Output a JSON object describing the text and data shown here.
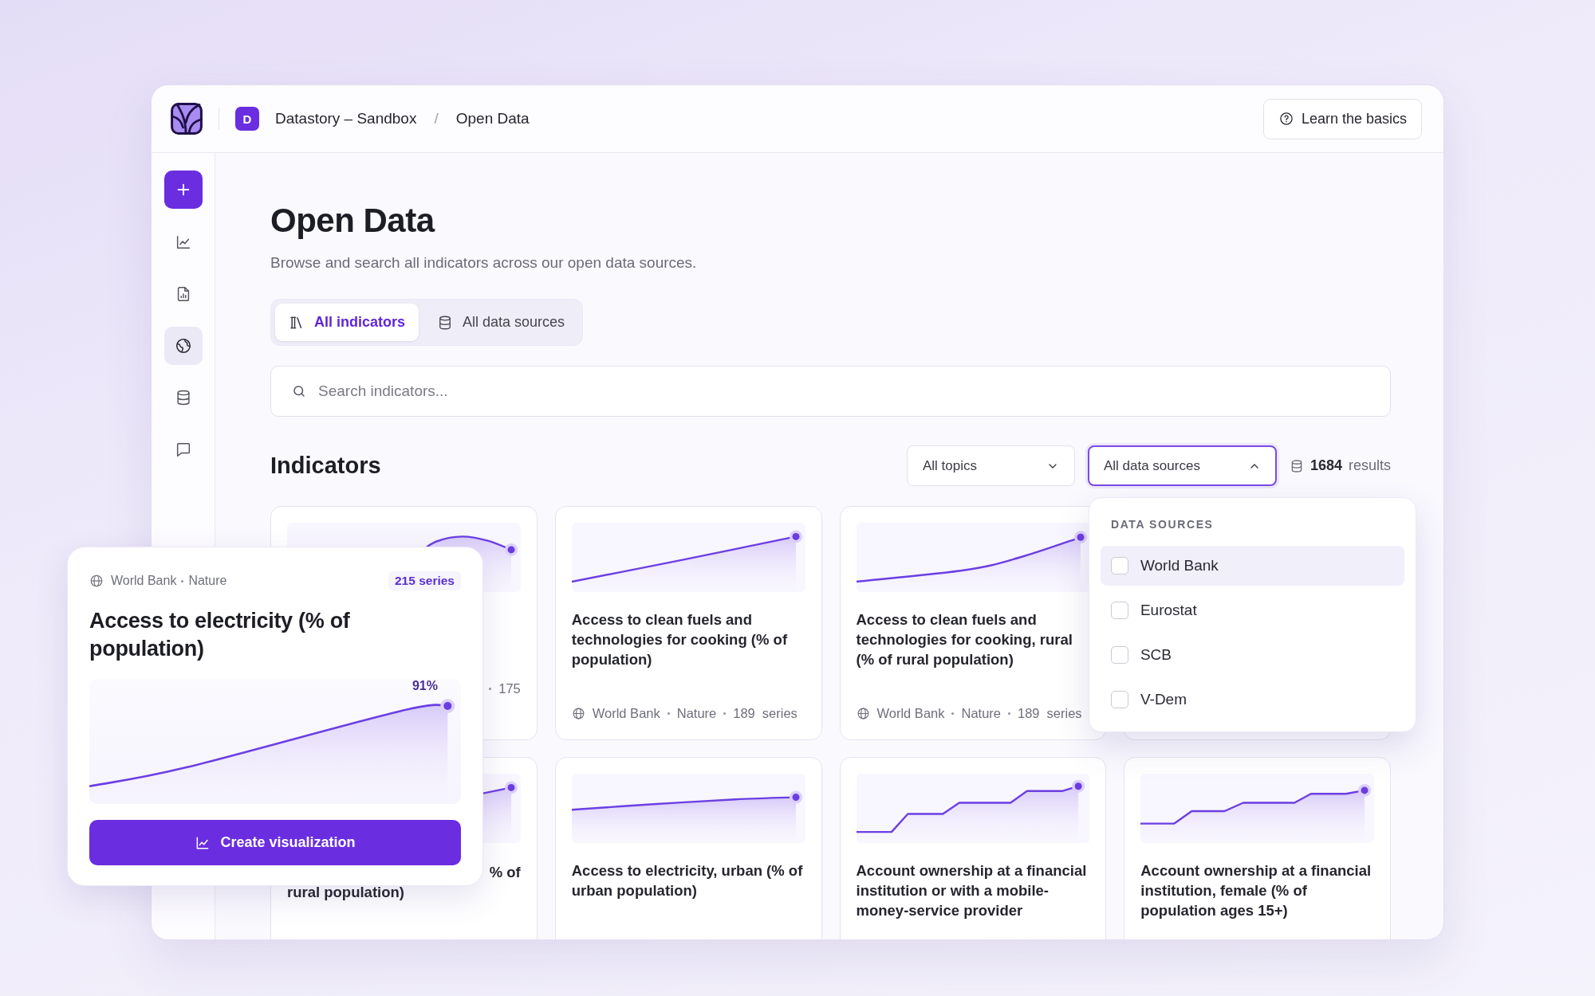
{
  "header": {
    "workspace_badge": "D",
    "workspace": "Datastory – Sandbox",
    "separator": "/",
    "page": "Open Data",
    "help_button": "Learn the basics"
  },
  "sidebar": {
    "items": [
      {
        "selected": false
      },
      {
        "selected": false
      },
      {
        "selected": true
      },
      {
        "selected": false
      },
      {
        "selected": false
      }
    ]
  },
  "page": {
    "title": "Open Data",
    "subtitle": "Browse and search all indicators across our open data sources."
  },
  "tabs": [
    {
      "label": "All indicators",
      "selected": true
    },
    {
      "label": "All data sources",
      "selected": false
    }
  ],
  "search": {
    "placeholder": "Search indicators..."
  },
  "indicators": {
    "heading": "Indicators",
    "filters": [
      {
        "label": "All topics",
        "expanded": false
      },
      {
        "label": "All data sources",
        "expanded": true,
        "menu": {
          "heading": "DATA SOURCES",
          "options": [
            {
              "label": "World Bank",
              "checked": false,
              "hovered": true
            },
            {
              "label": "Eurostat",
              "checked": false,
              "hovered": false
            },
            {
              "label": "SCB",
              "checked": false,
              "hovered": false
            },
            {
              "label": "V-Dem",
              "checked": false,
              "hovered": false
            }
          ]
        }
      }
    ],
    "result_count": "1684",
    "result_label": "results",
    "cards": [
      {
        "kind": "hump",
        "meta": {
          "count": "175"
        }
      },
      {
        "kind": "linear",
        "title": "Access to clean fuels and technologies for cooking (% of population)",
        "meta": {
          "source": "World Bank",
          "topic": "Nature",
          "count": "189",
          "unit": "series"
        }
      },
      {
        "kind": "curve",
        "title": "Access to clean fuels and technologies for cooking, rural (% of rural population)",
        "meta": {
          "source": "World Bank",
          "topic": "Nature",
          "count": "189",
          "unit": "series"
        }
      },
      {
        "kind": "covered"
      },
      {
        "kind": "linear",
        "title_lines": [
          "% of",
          "rural population)"
        ]
      },
      {
        "kind": "flat",
        "title": "Access to electricity, urban (% of urban population)"
      },
      {
        "kind": "steps",
        "title": "Account ownership at a financial institution or with a mobile-money-service provider"
      },
      {
        "kind": "staircase",
        "title": "Account ownership at a financial institution, female (% of population ages 15+)"
      }
    ]
  },
  "popover": {
    "source": "World Bank",
    "topic": "Nature",
    "series": "215 series",
    "title": "Access to electricity (% of population)",
    "value_label": "91%",
    "button": "Create visualization"
  }
}
